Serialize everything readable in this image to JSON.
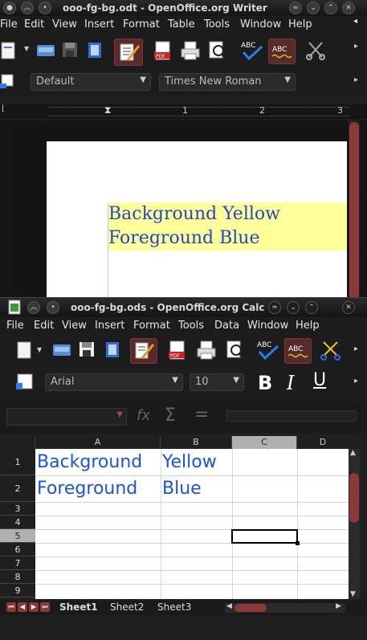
{
  "writer": {
    "title": "ooo-fg-bg.odt - OpenOffice.org Writer",
    "menu": [
      "File",
      "Edit",
      "View",
      "Insert",
      "Format",
      "Table",
      "Tools",
      "Window",
      "Help"
    ],
    "style_value": "Default",
    "font_value": "Times New Roman",
    "ruler_ticks": [
      "1",
      "2",
      "3"
    ],
    "text_line1": "Background Yellow",
    "text_line2": "Foreground Blue"
  },
  "calc": {
    "title": "ooo-fg-bg.ods - OpenOffice.org Calc",
    "menu": [
      "File",
      "Edit",
      "View",
      "Insert",
      "Format",
      "Tools",
      "Data",
      "Window",
      "Help"
    ],
    "font_value": "Arial",
    "size_value": "10",
    "bold_label": "B",
    "italic_label": "I",
    "underline_label": "U",
    "formula_icons": {
      "fx": "fx",
      "sum": "Σ",
      "eq": "="
    },
    "columns": [
      "A",
      "B",
      "C",
      "D"
    ],
    "rows": [
      "1",
      "2",
      "3",
      "4",
      "5",
      "6",
      "7",
      "8",
      "9"
    ],
    "cells": {
      "A1": "Background",
      "B1": "Yellow",
      "A2": "Foreground",
      "B2": "Blue"
    },
    "sheets": [
      "Sheet1",
      "Sheet2",
      "Sheet3"
    ]
  },
  "colors": {
    "text_blue": "#2047c8",
    "highlight_yellow": "#ffff99",
    "selection_header": "#b0b0b0"
  }
}
